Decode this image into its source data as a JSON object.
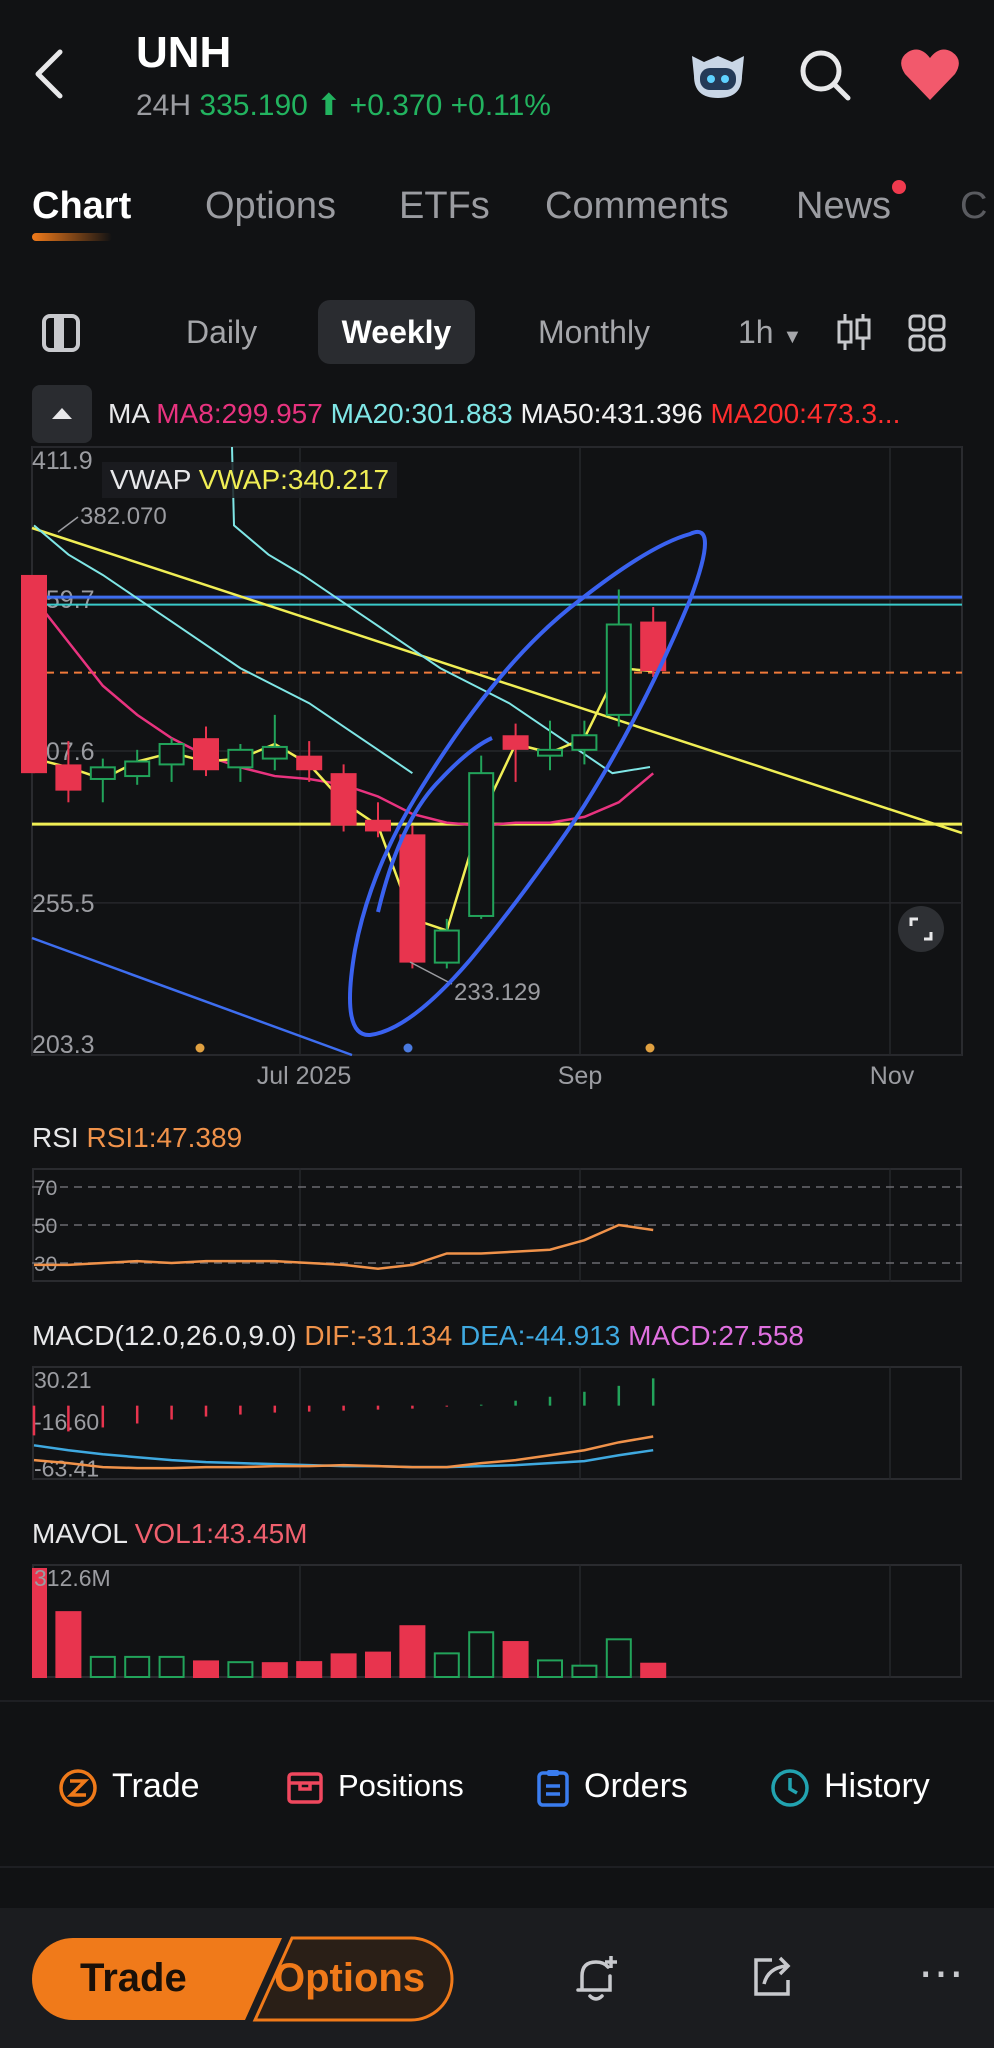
{
  "header": {
    "symbol": "UNH",
    "session_label": "24H",
    "price": "335.190",
    "change": "+0.370",
    "change_pct": "+0.11%"
  },
  "tabs": [
    {
      "label": "Chart",
      "active": true
    },
    {
      "label": "Options"
    },
    {
      "label": "ETFs"
    },
    {
      "label": "Comments"
    },
    {
      "label": "News"
    },
    {
      "label": "C"
    }
  ],
  "periods": [
    {
      "label": "Daily"
    },
    {
      "label": "Weekly",
      "active": true
    },
    {
      "label": "Monthly"
    },
    {
      "label": "1h"
    }
  ],
  "ma_legend": {
    "label": "MA",
    "ma8": "MA8:299.957",
    "ma20": "MA20:301.883",
    "ma50": "MA50:431.396",
    "ma200": "MA200:473.3..."
  },
  "vwap_legend": {
    "label": "VWAP",
    "value": "VWAP:340.217"
  },
  "chart_data": [
    {
      "type": "candlestick",
      "y_ticks": [
        "411.9",
        "359.7",
        "307.6",
        "255.5",
        "203.3"
      ],
      "ylim": [
        203.3,
        411.9
      ],
      "x_ticks": [
        "Jul 2025",
        "Sep",
        "Nov"
      ],
      "annotations": {
        "high": "382.070",
        "low": "233.129"
      },
      "candles": [
        {
          "o": 368,
          "h": 368,
          "c": 300,
          "l": 300,
          "color": "red"
        },
        {
          "o": 303,
          "h": 311,
          "c": 294,
          "l": 290,
          "color": "red"
        },
        {
          "o": 298,
          "h": 305,
          "c": 302,
          "l": 290,
          "color": "green"
        },
        {
          "o": 299,
          "h": 308,
          "c": 304,
          "l": 296,
          "color": "green"
        },
        {
          "o": 303,
          "h": 312,
          "c": 310,
          "l": 297,
          "color": "green"
        },
        {
          "o": 312,
          "h": 316,
          "c": 301,
          "l": 299,
          "color": "red"
        },
        {
          "o": 302,
          "h": 310,
          "c": 308,
          "l": 297,
          "color": "green"
        },
        {
          "o": 305,
          "h": 320,
          "c": 309,
          "l": 301,
          "color": "green"
        },
        {
          "o": 306,
          "h": 311,
          "c": 301,
          "l": 297,
          "color": "red"
        },
        {
          "o": 300,
          "h": 303,
          "c": 282,
          "l": 280,
          "color": "red"
        },
        {
          "o": 284,
          "h": 290,
          "c": 280,
          "l": 278,
          "color": "red"
        },
        {
          "o": 279,
          "h": 282,
          "c": 235,
          "l": 233,
          "color": "red"
        },
        {
          "o": 235,
          "h": 250,
          "c": 246,
          "l": 233,
          "color": "green"
        },
        {
          "o": 251,
          "h": 306,
          "c": 300,
          "l": 250,
          "color": "green"
        },
        {
          "o": 313,
          "h": 317,
          "c": 308,
          "l": 297,
          "color": "red"
        },
        {
          "o": 306,
          "h": 318,
          "c": 308,
          "l": 301,
          "color": "green"
        },
        {
          "o": 308,
          "h": 318,
          "c": 313,
          "l": 303,
          "color": "green"
        },
        {
          "o": 320,
          "h": 363,
          "c": 351,
          "l": 316,
          "color": "green"
        },
        {
          "o": 352,
          "h": 357,
          "c": 335,
          "l": 333,
          "color": "red"
        }
      ],
      "ma8": [
        360,
        345,
        330,
        320,
        312,
        306,
        302,
        299,
        298,
        296,
        292,
        286,
        283,
        282,
        283,
        283,
        285,
        290,
        299.957
      ],
      "ma20": [
        385,
        375,
        368,
        360,
        352,
        344,
        336,
        330,
        324,
        316,
        308,
        300
      ],
      "vwap": [
        305,
        302,
        298,
        304,
        307,
        304,
        305,
        310,
        303,
        290,
        282,
        250,
        246,
        285,
        310,
        307,
        312,
        336,
        335
      ],
      "horizontal_lines": {
        "blue": 359.7,
        "teal": 358.5,
        "orange_dashed": 334.5,
        "yellow": 282.5
      }
    },
    {
      "type": "line",
      "legend": "RSI",
      "value_label": "RSI1:47.389",
      "y_ticks": [
        "70",
        "50",
        "30"
      ],
      "ylim": [
        20,
        80
      ],
      "values": [
        29,
        29,
        30,
        31,
        30,
        31,
        31,
        31,
        30,
        29,
        27,
        29,
        35,
        35,
        36,
        37,
        42,
        50,
        47.389
      ]
    },
    {
      "type": "bar+line",
      "legend": "MACD(12.0,26.0,9.0)",
      "dif_label": "DIF:-31.134",
      "dea_label": "DEA:-44.913",
      "macd_label": "MACD:27.558",
      "y_ticks": [
        "30.21",
        "-16.60",
        "-63.41"
      ],
      "ylim": [
        -75,
        40
      ],
      "hist": [
        -30,
        -26,
        -22,
        -18,
        -14,
        -11,
        -9,
        -7,
        -6,
        -5,
        -4,
        -3,
        -1,
        1,
        5,
        9,
        14,
        20,
        27.558
      ],
      "dif": [
        -55,
        -58,
        -62,
        -63,
        -63,
        -62,
        -62,
        -61,
        -61,
        -60,
        -61,
        -62,
        -62,
        -58,
        -55,
        -50,
        -45,
        -37,
        -31.134
      ],
      "dea": [
        -40,
        -45,
        -49,
        -52,
        -55,
        -57,
        -58,
        -59,
        -60,
        -61,
        -61,
        -62,
        -62,
        -61,
        -60,
        -58,
        -56,
        -50,
        -44.913
      ]
    },
    {
      "type": "bar",
      "legend": "MAVOL",
      "value_label": "VOL1:43.45M",
      "y_ticks": [
        "312.6M"
      ],
      "ylim": [
        0,
        312.6
      ],
      "values": [
        312.6,
        190,
        60,
        60,
        60,
        50,
        45,
        45,
        48,
        70,
        75,
        150,
        70,
        130,
        105,
        50,
        35,
        110,
        43.45
      ],
      "colors": [
        "red",
        "red",
        "green",
        "green",
        "green",
        "red",
        "green",
        "red",
        "red",
        "red",
        "red",
        "red",
        "green",
        "green",
        "red",
        "green",
        "green",
        "green",
        "red"
      ]
    }
  ],
  "action_bar": {
    "trade": "Trade",
    "positions": "Positions",
    "orders": "Orders",
    "history": "History"
  },
  "footer": {
    "trade_button": "Trade",
    "options_button": "Options",
    "more": "⋯"
  },
  "colors": {
    "red": "#e8344e",
    "green": "#22a35a",
    "accent": "#f07a1a",
    "ma8": "#e8337f",
    "ma20": "#7fe6e6",
    "vwap": "#f0ee55",
    "blue_line": "#3e6ef0"
  }
}
